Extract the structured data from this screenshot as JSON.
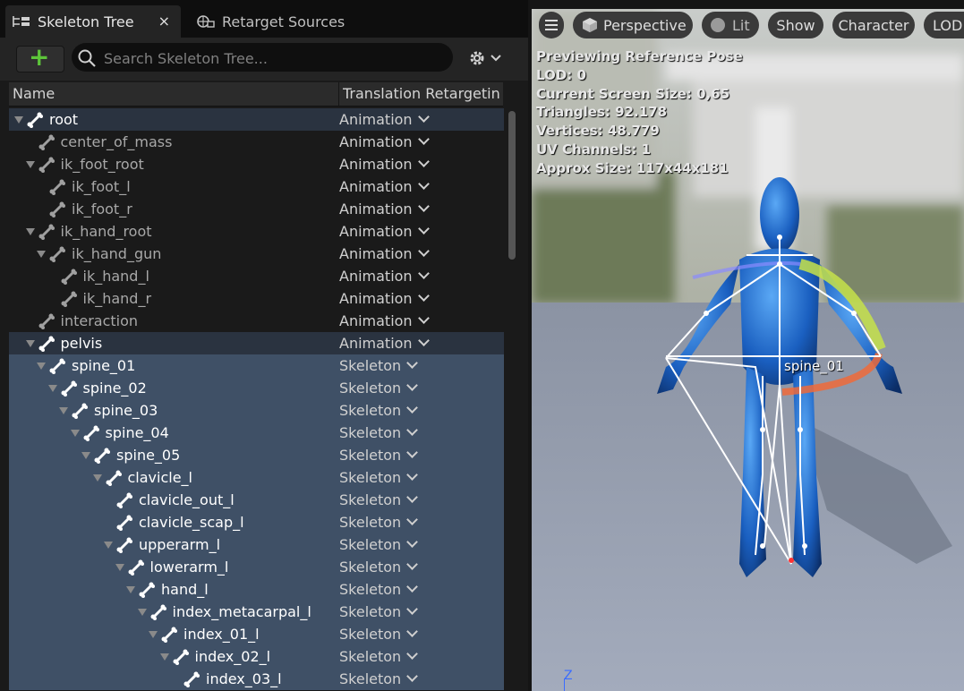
{
  "tabs": {
    "skeleton_tree": "Skeleton Tree",
    "close": "×",
    "retarget_sources": "Retarget Sources"
  },
  "search": {
    "placeholder": "Search Skeleton Tree..."
  },
  "columns": {
    "name": "Name",
    "retargeting": "Translation Retargeting"
  },
  "tree": [
    {
      "name": "root",
      "depth": 0,
      "arrow": true,
      "retarget": "Animation",
      "style": "hl",
      "bright": true
    },
    {
      "name": "center_of_mass",
      "depth": 1,
      "arrow": false,
      "retarget": "Animation",
      "style": "",
      "bright": false
    },
    {
      "name": "ik_foot_root",
      "depth": 1,
      "arrow": true,
      "retarget": "Animation",
      "style": "",
      "bright": false
    },
    {
      "name": "ik_foot_l",
      "depth": 2,
      "arrow": false,
      "retarget": "Animation",
      "style": "",
      "bright": false
    },
    {
      "name": "ik_foot_r",
      "depth": 2,
      "arrow": false,
      "retarget": "Animation",
      "style": "",
      "bright": false
    },
    {
      "name": "ik_hand_root",
      "depth": 1,
      "arrow": true,
      "retarget": "Animation",
      "style": "",
      "bright": false
    },
    {
      "name": "ik_hand_gun",
      "depth": 2,
      "arrow": true,
      "retarget": "Animation",
      "style": "",
      "bright": false
    },
    {
      "name": "ik_hand_l",
      "depth": 3,
      "arrow": false,
      "retarget": "Animation",
      "style": "",
      "bright": false
    },
    {
      "name": "ik_hand_r",
      "depth": 3,
      "arrow": false,
      "retarget": "Animation",
      "style": "",
      "bright": false
    },
    {
      "name": "interaction",
      "depth": 1,
      "arrow": false,
      "retarget": "Animation",
      "style": "",
      "bright": false
    },
    {
      "name": "pelvis",
      "depth": 1,
      "arrow": true,
      "retarget": "Animation",
      "style": "hl",
      "bright": true
    },
    {
      "name": "spine_01",
      "depth": 2,
      "arrow": true,
      "retarget": "Skeleton",
      "style": "sel",
      "bright": true
    },
    {
      "name": "spine_02",
      "depth": 3,
      "arrow": true,
      "retarget": "Skeleton",
      "style": "sel",
      "bright": true
    },
    {
      "name": "spine_03",
      "depth": 4,
      "arrow": true,
      "retarget": "Skeleton",
      "style": "sel",
      "bright": true
    },
    {
      "name": "spine_04",
      "depth": 5,
      "arrow": true,
      "retarget": "Skeleton",
      "style": "sel",
      "bright": true
    },
    {
      "name": "spine_05",
      "depth": 6,
      "arrow": true,
      "retarget": "Skeleton",
      "style": "sel",
      "bright": true
    },
    {
      "name": "clavicle_l",
      "depth": 7,
      "arrow": true,
      "retarget": "Skeleton",
      "style": "sel",
      "bright": true
    },
    {
      "name": "clavicle_out_l",
      "depth": 8,
      "arrow": false,
      "retarget": "Skeleton",
      "style": "sel",
      "bright": true
    },
    {
      "name": "clavicle_scap_l",
      "depth": 8,
      "arrow": false,
      "retarget": "Skeleton",
      "style": "sel",
      "bright": true
    },
    {
      "name": "upperarm_l",
      "depth": 8,
      "arrow": true,
      "retarget": "Skeleton",
      "style": "sel",
      "bright": true
    },
    {
      "name": "lowerarm_l",
      "depth": 9,
      "arrow": true,
      "retarget": "Skeleton",
      "style": "sel",
      "bright": true
    },
    {
      "name": "hand_l",
      "depth": 10,
      "arrow": true,
      "retarget": "Skeleton",
      "style": "sel",
      "bright": true
    },
    {
      "name": "index_metacarpal_l",
      "depth": 11,
      "arrow": true,
      "retarget": "Skeleton",
      "style": "sel",
      "bright": true
    },
    {
      "name": "index_01_l",
      "depth": 12,
      "arrow": true,
      "retarget": "Skeleton",
      "style": "sel",
      "bright": true
    },
    {
      "name": "index_02_l",
      "depth": 13,
      "arrow": true,
      "retarget": "Skeleton",
      "style": "sel",
      "bright": true
    },
    {
      "name": "index_03_l",
      "depth": 14,
      "arrow": false,
      "retarget": "Skeleton",
      "style": "sel",
      "bright": true
    }
  ],
  "viewport": {
    "perspective": "Perspective",
    "lit": "Lit",
    "show": "Show",
    "character": "Character",
    "lod": "LOD",
    "info": [
      "Previewing Reference Pose",
      "LOD: 0",
      "Current Screen Size: 0,65",
      "Triangles: 92.178",
      "Vertices: 48.779",
      "UV Channels: 1",
      "Approx Size: 117x44x181"
    ],
    "bone_label": "spine_01",
    "axis": "Z"
  },
  "colors": {
    "selection": "#3f5066",
    "accent": "#5dc53a",
    "axis": "#3b6dff"
  }
}
